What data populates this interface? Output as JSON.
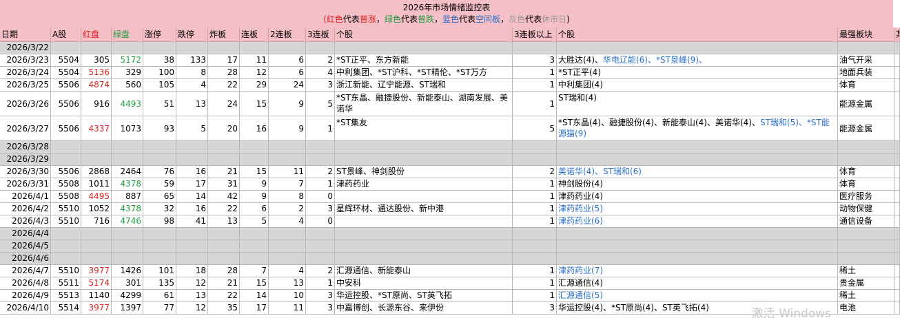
{
  "title": {
    "line1": "2026年市场情绪监控表",
    "legend": [
      {
        "text": "(",
        "color": "red"
      },
      {
        "text": "红色",
        "color": "red"
      },
      {
        "text": "代表",
        "color": "black"
      },
      {
        "text": "普涨",
        "color": "red"
      },
      {
        "text": "，",
        "color": "black"
      },
      {
        "text": "绿色",
        "color": "green"
      },
      {
        "text": "代表",
        "color": "black"
      },
      {
        "text": "普跌",
        "color": "green"
      },
      {
        "text": "，",
        "color": "black"
      },
      {
        "text": "蓝色",
        "color": "blue"
      },
      {
        "text": "代表",
        "color": "black"
      },
      {
        "text": "空间板",
        "color": "blue"
      },
      {
        "text": "，",
        "color": "black"
      },
      {
        "text": "灰色",
        "color": "gray"
      },
      {
        "text": "代表",
        "color": "black"
      },
      {
        "text": "休市日",
        "color": "gray"
      },
      {
        "text": ")",
        "color": "black"
      }
    ]
  },
  "headers": [
    "日期",
    "A股",
    "红盘",
    "绿盘",
    "涨停",
    "跌停",
    "炸板",
    "连板",
    "2连板",
    "3连板",
    "个股",
    "3连板以上",
    "个股",
    "最强板块",
    "某"
  ],
  "rows": [
    {
      "date": "2026/3/22",
      "closed": true
    },
    {
      "date": "2026/3/23",
      "a": "5504",
      "up": "305",
      "down": "5172",
      "mood": "down",
      "zt": "38",
      "dt": "133",
      "zb": "17",
      "lb": "11",
      "lb2": "6",
      "lb3": "2",
      "stocks3": "*ST正平、东方新能",
      "lb3p": "3",
      "stocks3p": [
        {
          "t": "大胜达(4)、",
          "c": ""
        },
        {
          "t": "华电辽能(6)、*ST景峰(9)、",
          "c": "blue"
        }
      ],
      "sector": "油气开采"
    },
    {
      "date": "2026/3/24",
      "a": "5504",
      "up": "5136",
      "down": "329",
      "mood": "up",
      "zt": "100",
      "dt": "8",
      "zb": "28",
      "lb": "12",
      "lb2": "6",
      "lb3": "4",
      "stocks3": "中利集团、*ST沪科、*ST精伦、*ST万方",
      "lb3p": "1",
      "stocks3p": [
        {
          "t": "*ST正平(4)",
          "c": ""
        }
      ],
      "sector": "地面兵装"
    },
    {
      "date": "2026/3/25",
      "a": "5506",
      "up": "4874",
      "down": "560",
      "mood": "up",
      "zt": "105",
      "dt": "4",
      "zb": "22",
      "lb": "29",
      "lb2": "24",
      "lb3": "3",
      "stocks3": "浙江新能、辽宁能源、ST瑞和",
      "lb3p": "1",
      "stocks3p": [
        {
          "t": "中利集团(4)",
          "c": ""
        }
      ],
      "sector": "体育"
    },
    {
      "date": "2026/3/26",
      "a": "5506",
      "up": "916",
      "down": "4493",
      "mood": "down",
      "zt": "51",
      "dt": "13",
      "zb": "24",
      "lb": "15",
      "lb2": "9",
      "lb3": "5",
      "stocks3": "*ST东晶、融捷股份、新能泰山、湖南发展、美诺华",
      "lb3p": "1",
      "stocks3p": [
        {
          "t": "ST瑞和(4)",
          "c": ""
        }
      ],
      "sector": "能源金属",
      "tall": true
    },
    {
      "date": "2026/3/27",
      "a": "5506",
      "up": "4337",
      "down": "1073",
      "mood": "up",
      "zt": "93",
      "dt": "5",
      "zb": "20",
      "lb": "16",
      "lb2": "9",
      "lb3": "1",
      "stocks3": "*ST集友",
      "lb3p": "5",
      "stocks3p": [
        {
          "t": "*ST东晶(4)、融捷股份(4)、新能泰山(4)、美诺华(4)、",
          "c": ""
        },
        {
          "t": "ST瑞和(5)、*ST能源猫(9)",
          "c": "blue"
        }
      ],
      "sector": "能源金属",
      "tall": true
    },
    {
      "date": "2026/3/28",
      "closed": true
    },
    {
      "date": "2026/3/29",
      "closed": true
    },
    {
      "date": "2026/3/30",
      "a": "5506",
      "up": "2868",
      "down": "2464",
      "mood": "",
      "zt": "76",
      "dt": "16",
      "zb": "21",
      "lb": "15",
      "lb2": "11",
      "lb3": "2",
      "stocks3": "ST景峰、神剑股份",
      "lb3p": "2",
      "stocks3p": [
        {
          "t": "美诺华(4)、ST瑞和(6)",
          "c": "blue"
        }
      ],
      "sector": "体育"
    },
    {
      "date": "2026/3/31",
      "a": "5508",
      "up": "1011",
      "down": "4378",
      "mood": "down",
      "zt": "59",
      "dt": "17",
      "zb": "31",
      "lb": "9",
      "lb2": "7",
      "lb3": "1",
      "stocks3": "津药药业",
      "lb3p": "1",
      "stocks3p": [
        {
          "t": "神剑股份(4)",
          "c": ""
        }
      ],
      "sector": "体育"
    },
    {
      "date": "2026/4/1",
      "a": "5508",
      "up": "4495",
      "down": "887",
      "mood": "up",
      "zt": "65",
      "dt": "14",
      "zb": "42",
      "lb": "9",
      "lb2": "8",
      "lb3": "0",
      "stocks3": "",
      "lb3p": "1",
      "stocks3p": [
        {
          "t": "津药药业(4)",
          "c": ""
        }
      ],
      "sector": "医疗服务"
    },
    {
      "date": "2026/4/2",
      "a": "5510",
      "up": "1052",
      "down": "4378",
      "mood": "down",
      "zt": "32",
      "dt": "16",
      "zb": "22",
      "lb": "6",
      "lb2": "2",
      "lb3": "3",
      "stocks3": "星辉环材、通达股份、新中港",
      "lb3p": "1",
      "stocks3p": [
        {
          "t": "津药药业(5)",
          "c": "blue"
        }
      ],
      "sector": "动物保健"
    },
    {
      "date": "2026/4/3",
      "a": "5510",
      "up": "716",
      "down": "4746",
      "mood": "down",
      "zt": "98",
      "dt": "41",
      "zb": "13",
      "lb": "5",
      "lb2": "4",
      "lb3": "0",
      "stocks3": "",
      "lb3p": "1",
      "stocks3p": [
        {
          "t": "津药药业(6)",
          "c": "blue"
        }
      ],
      "sector": "通信设备"
    },
    {
      "date": "2026/4/4",
      "closed": true
    },
    {
      "date": "2026/4/5",
      "closed": true
    },
    {
      "date": "2026/4/6",
      "closed": true
    },
    {
      "date": "2026/4/7",
      "a": "5510",
      "up": "3977",
      "down": "1426",
      "mood": "up",
      "zt": "101",
      "dt": "18",
      "zb": "28",
      "lb": "7",
      "lb2": "4",
      "lb3": "2",
      "stocks3": "汇源通信、新能泰山",
      "lb3p": "1",
      "stocks3p": [
        {
          "t": "津药药业(7)",
          "c": "blue"
        }
      ],
      "sector": "稀土"
    },
    {
      "date": "2026/4/8",
      "a": "5511",
      "up": "5174",
      "down": "301",
      "mood": "up",
      "zt": "135",
      "dt": "12",
      "zb": "21",
      "lb": "15",
      "lb2": "13",
      "lb3": "1",
      "stocks3": "中安科",
      "lb3p": "1",
      "stocks3p": [
        {
          "t": "汇源通信(4)",
          "c": ""
        }
      ],
      "sector": "贵金属"
    },
    {
      "date": "2026/4/9",
      "a": "5513",
      "up": "1140",
      "down": "4299",
      "mood": "",
      "zt": "61",
      "dt": "13",
      "zb": "22",
      "lb": "14",
      "lb2": "10",
      "lb3": "3",
      "stocks3": "华运控股、*ST原尚、ST英飞拓",
      "lb3p": "1",
      "stocks3p": [
        {
          "t": "汇源通信(5)",
          "c": "blue"
        }
      ],
      "sector": "稀土"
    },
    {
      "date": "2026/4/10",
      "a": "5514",
      "up": "3977",
      "down": "1397",
      "mood": "up",
      "zt": "77",
      "dt": "12",
      "zb": "35",
      "lb": "17",
      "lb2": "11",
      "lb3": "3",
      "stocks3": "中嘉博创、长源东谷、来伊份",
      "lb3p": "3",
      "stocks3p": [
        {
          "t": "华运控股(4)、*ST原尚(4)、ST英飞拓(4)",
          "c": ""
        }
      ],
      "sector": "电池"
    }
  ],
  "watermark": "激活 Windows"
}
